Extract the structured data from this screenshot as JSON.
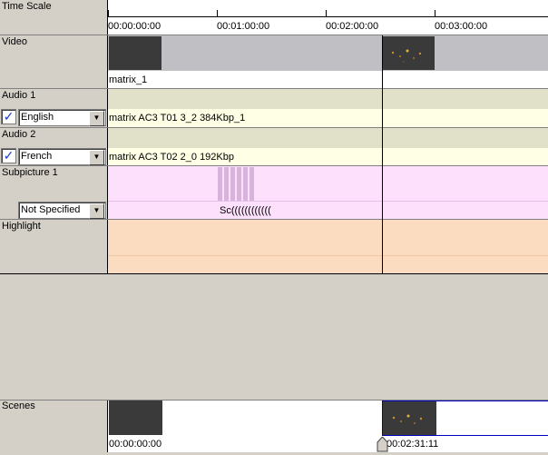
{
  "tracks": {
    "time_scale": "Time Scale",
    "video": "Video",
    "audio1": "Audio 1",
    "audio2": "Audio 2",
    "subpicture1": "Subpicture 1",
    "highlight": "Highlight",
    "scenes": "Scenes"
  },
  "timescale": {
    "ticks": [
      "00:00:00:00",
      "00:01:00:00",
      "00:02:00:00",
      "00:03:00:00"
    ]
  },
  "video": {
    "clip_name": "matrix_1"
  },
  "audio1": {
    "checked": true,
    "language": "English",
    "clip": "matrix AC3 T01 3_2 384Kbp_1"
  },
  "audio2": {
    "checked": true,
    "language": "French",
    "clip": "matrix AC3 T02 2_0 192Kbp"
  },
  "subpicture1": {
    "language": "Not Specified",
    "labels": "Sc(((((((((((("
  },
  "scenes": {
    "start": "00:00:00:00",
    "playhead": "00:02:31:11"
  },
  "colors": {
    "video_bg": "#c0c0c4",
    "audio_bg": "#ffffe6",
    "audio_band": "#e1e0c8",
    "subpicture_bg": "#fce0fc",
    "highlight_bg": "#fbdcc0",
    "selection": "#0000c0"
  },
  "icons": {
    "check": "checkmark-icon",
    "dropdown": "dropdown-arrow-icon",
    "playhead": "playhead-marker-icon"
  }
}
